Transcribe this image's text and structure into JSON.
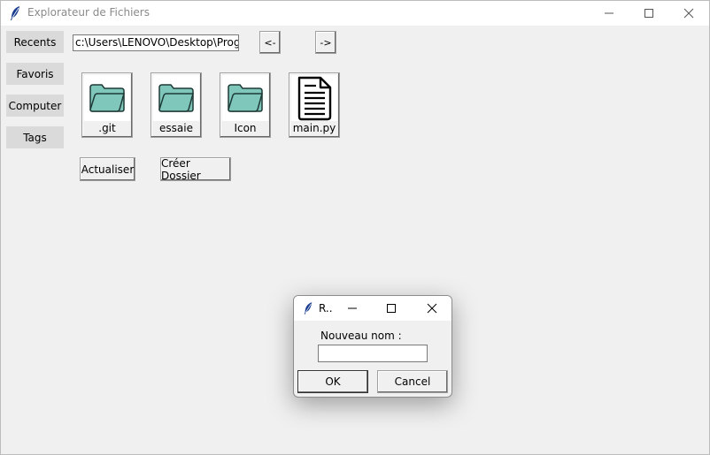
{
  "window": {
    "title": "Explorateur de Fichiers"
  },
  "sidebar": {
    "items": [
      {
        "label": "Recents"
      },
      {
        "label": "Favoris"
      },
      {
        "label": "Computer"
      },
      {
        "label": "Tags"
      }
    ]
  },
  "toolbar": {
    "path_value": "c:\\Users\\LENOVO\\Desktop\\Program",
    "back_label": "<-",
    "forward_label": "->"
  },
  "files": [
    {
      "name": ".git",
      "icon": "folder-icon"
    },
    {
      "name": "essaie",
      "icon": "folder-icon"
    },
    {
      "name": "Icon",
      "icon": "folder-icon"
    },
    {
      "name": "main.py",
      "icon": "document-icon"
    }
  ],
  "actions": {
    "refresh_label": "Actualiser",
    "create_folder_label": "Créer Dossier"
  },
  "dialog": {
    "title": "R..",
    "prompt": "Nouveau nom :",
    "input_value": "",
    "ok_label": "OK",
    "cancel_label": "Cancel"
  },
  "colors": {
    "folder_fill": "#7fc7bb",
    "folder_stroke": "#1e3a36",
    "window_bg": "#f0f0f0",
    "sidebar_button_bg": "#dadada"
  }
}
